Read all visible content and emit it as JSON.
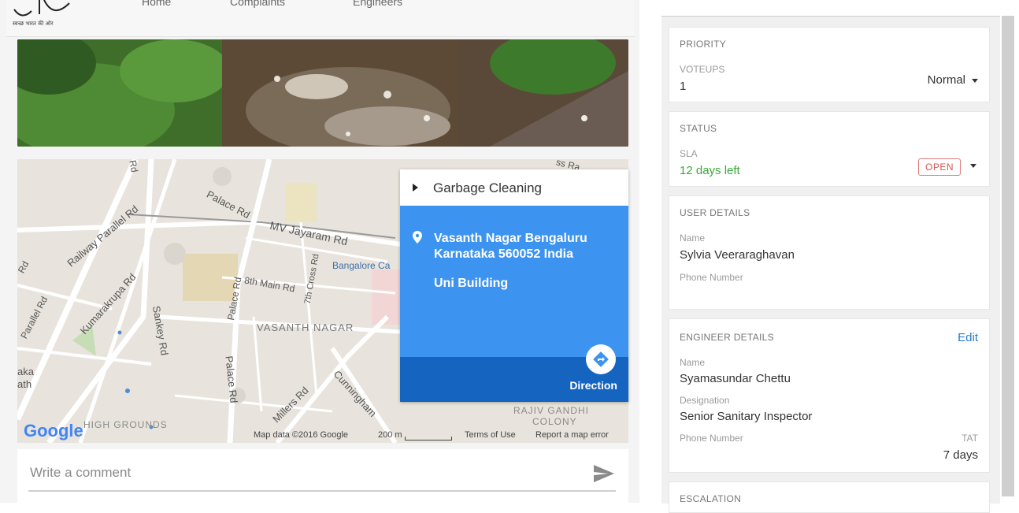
{
  "header": {
    "logo_caption": "स्वच्छ भारत की ओर",
    "nav": [
      "Home",
      "Complaints",
      "Engineers"
    ]
  },
  "map": {
    "labels": {
      "railway_parallel_rd": "Railway Parallel Rd",
      "palace_rd_top": "Palace Rd",
      "mv_jayaram_rd": "MV Jayaram Rd",
      "bangalore_ca": "Bangalore Ca",
      "kumarakrupa_rd": "Kumarakrupa Rd",
      "sankey_rd": "Sankey Rd",
      "palace_rd_mid": "Palace Rd",
      "palace_rd_low": "Palace Rd",
      "main_rd_8th": "8th Main Rd",
      "cross_rd_7th": "7th Cross Rd",
      "vasanth_nagar": "VASANTH NAGAR",
      "cunningham": "Cunningham",
      "millers_rd": "Millers Rd",
      "rajiv_gandhi": "RAJIV GANDHI",
      "colony": "COLONY",
      "high_grounds": "HIGH GROUNDS",
      "aka": "aka",
      "ath": "ath",
      "parallel_rd_left": "Parallel Rd",
      "rd_left": "Rd",
      "rd_top": "Rd",
      "ss_ra": "ss Ra"
    },
    "google": "Google",
    "footer": {
      "map_data": "Map data ©2016 Google",
      "scale": "200 m",
      "terms": "Terms of Use",
      "report": "Report a map error"
    },
    "info": {
      "title": "Garbage Cleaning",
      "address_line1": "Vasanth Nagar Bengaluru",
      "address_line2": "Karnataka 560052 India",
      "building": "Uni Building",
      "direction": "Direction"
    }
  },
  "comment": {
    "placeholder": "Write a comment"
  },
  "sidebar": {
    "priority": {
      "title": "PRIORITY",
      "label": "VOTEUPS",
      "value": "1",
      "selected": "Normal"
    },
    "status": {
      "title": "STATUS",
      "label": "SLA",
      "value": "12 days left",
      "badge": "OPEN"
    },
    "user": {
      "title": "USER DETAILS",
      "name_label": "Name",
      "name": "Sylvia Veeraraghavan",
      "phone_label": "Phone Number"
    },
    "engineer": {
      "title": "ENGINEER DETAILS",
      "edit": "Edit",
      "name_label": "Name",
      "name": "Syamasundar Chettu",
      "designation_label": "Designation",
      "designation": "Senior Sanitary Inspector",
      "phone_label": "Phone Number",
      "tat_label": "TAT",
      "tat": "7 days"
    },
    "escalation": {
      "title": "ESCALATION"
    }
  },
  "colors": {
    "accent_blue": "#3d94f0",
    "accent_dark_blue": "#1565c0",
    "sla_green": "#3aa83a",
    "open_red": "#d9534f",
    "link_blue": "#2a7bd0"
  }
}
